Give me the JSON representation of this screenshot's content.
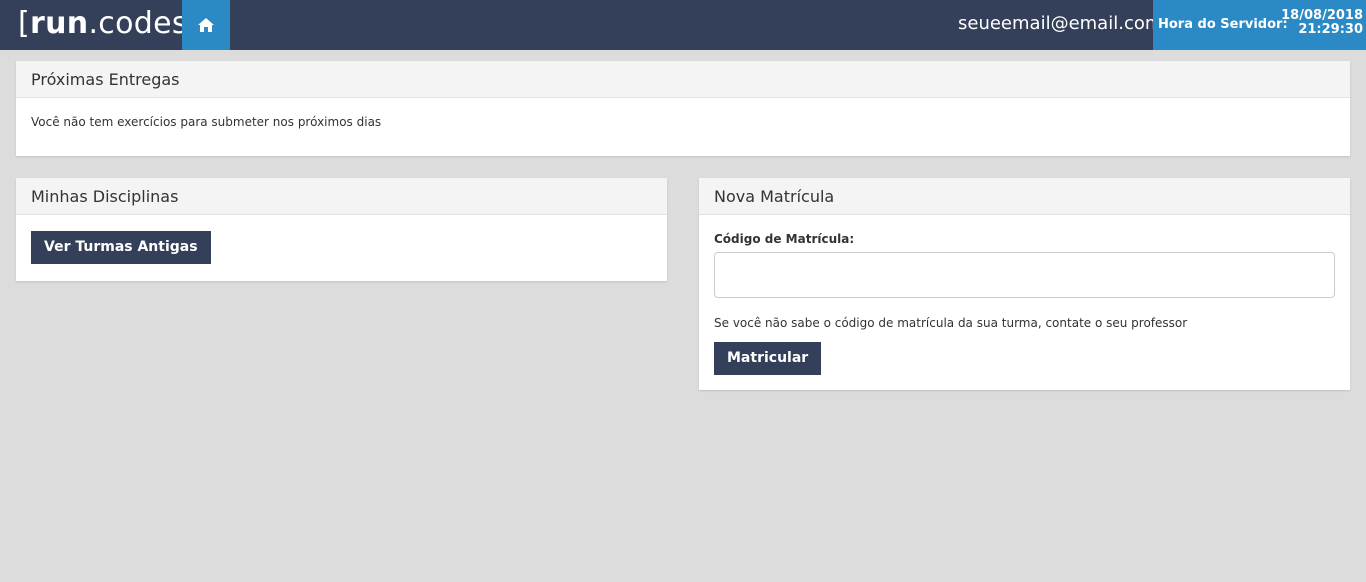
{
  "header": {
    "logo": {
      "bracket_open": "[",
      "run": "run",
      "dot_codes": ".codes",
      "bracket_close": "]"
    },
    "user_email": "seueemail@email.com",
    "server": {
      "label": "Hora do Servidor:",
      "date": "18/08/2018",
      "time": "21:29:30"
    },
    "colors": {
      "bar": "#34405a",
      "accent": "#2b8ac6"
    }
  },
  "upcoming": {
    "title": "Próximas Entregas",
    "message": "Você não tem exercícios para submeter nos próximos dias"
  },
  "disciplines": {
    "title": "Minhas Disciplinas",
    "old_classes_button": "Ver Turmas Antigas"
  },
  "enrollment": {
    "title": "Nova Matrícula",
    "code_label": "Código de Matrícula:",
    "code_value": "",
    "hint": "Se você não sabe o código de matrícula da sua turma, contate o seu professor",
    "submit_button": "Matricular"
  }
}
